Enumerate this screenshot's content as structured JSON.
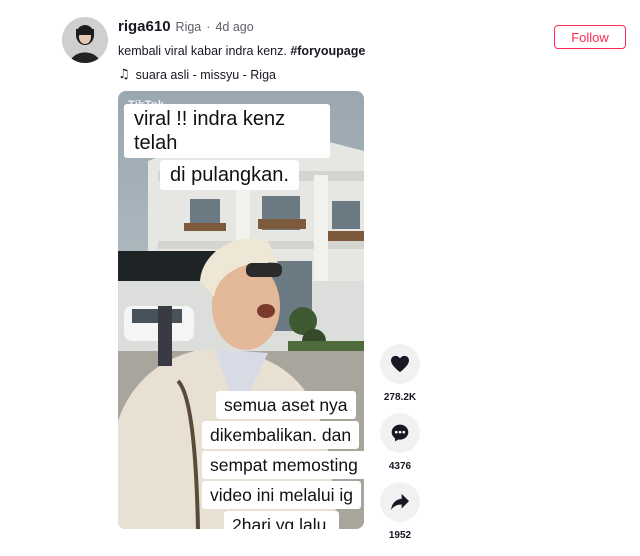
{
  "header": {
    "username": "riga610",
    "nickname": "Riga",
    "separator": "·",
    "time_ago": "4d ago",
    "caption_text": "kembali viral kabar indra kenz.",
    "caption_hashtag": "#foryoupage",
    "music_icon": "music-note-icon",
    "music": "suara asli - missyu - Riga",
    "follow_label": "Follow"
  },
  "video": {
    "watermark": "TikTok",
    "overlay_top": [
      "viral !! indra kenz telah",
      "di pulangkan."
    ],
    "overlay_bottom": [
      "semua aset nya",
      "dikembalikan. dan",
      "sempat memosting",
      "video ini melalui ig",
      "2hari yg lalu."
    ]
  },
  "actions": {
    "likes": "278.2K",
    "comments": "4376",
    "shares": "1952"
  },
  "colors": {
    "accent": "#fe2c55",
    "action_bg": "#f1f1f2"
  }
}
